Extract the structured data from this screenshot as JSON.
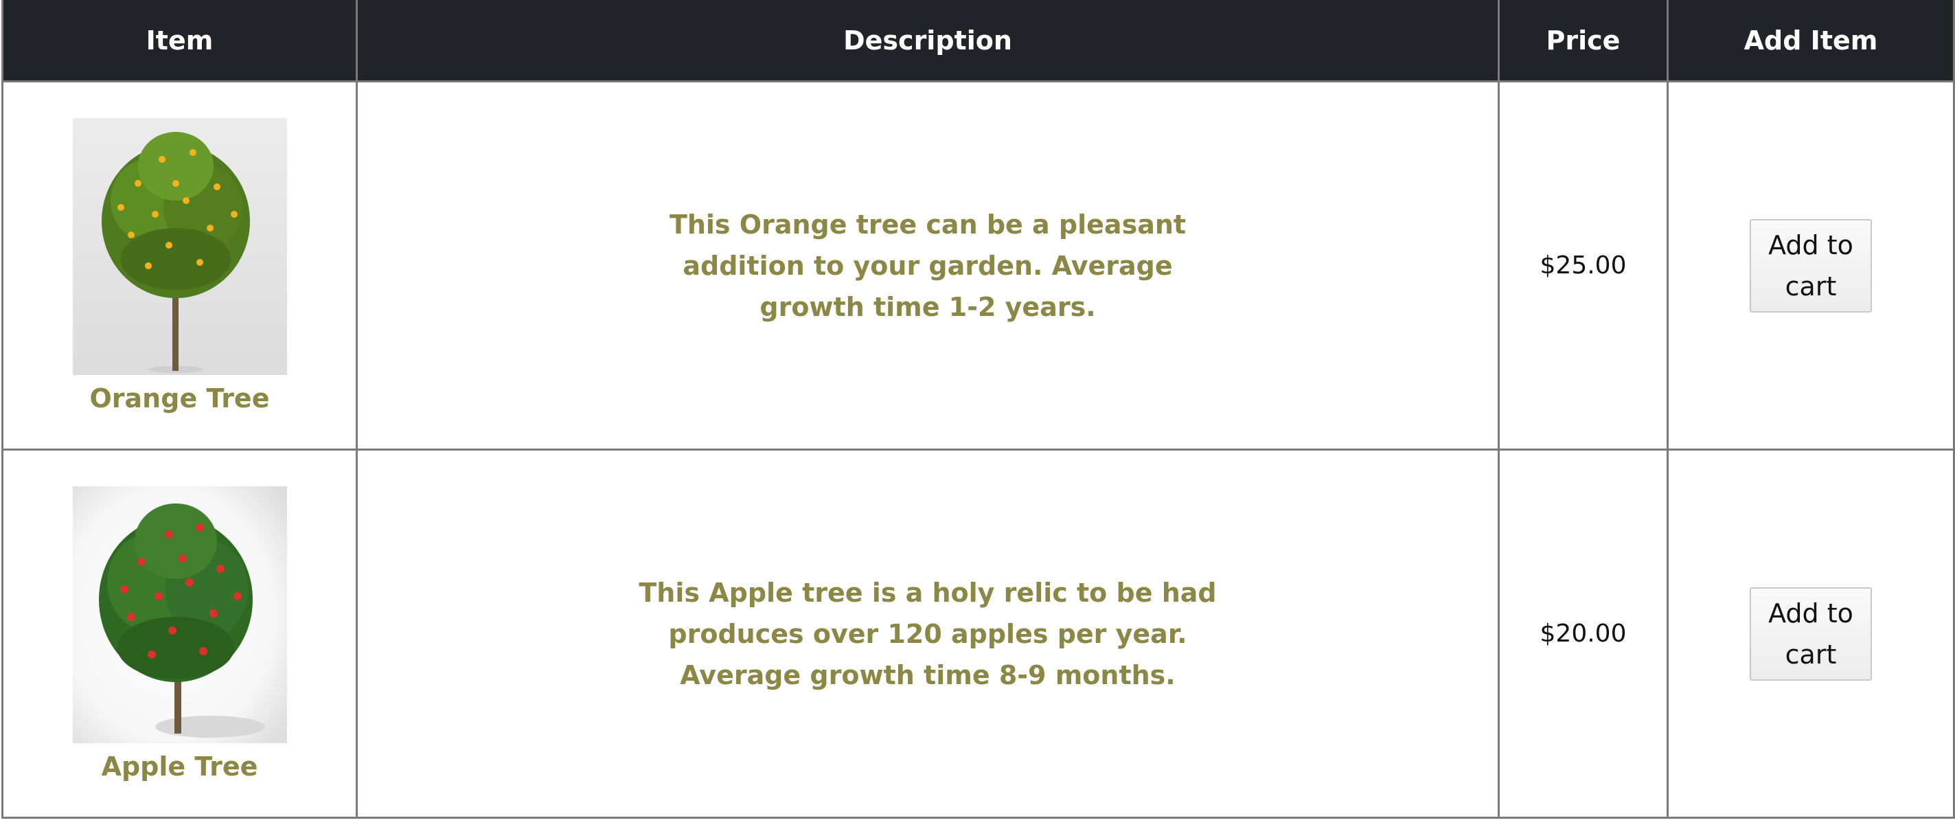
{
  "table": {
    "headers": [
      "Item",
      "Description",
      "Price",
      "Add Item"
    ],
    "rows": [
      {
        "name": "Orange Tree",
        "image": "orange-tree-image",
        "description": "This Orange tree can be a pleasant addition to your garden. Average growth time 1-2 years.",
        "price": "$25.00",
        "button_label": "Add to cart"
      },
      {
        "name": "Apple Tree",
        "image": "apple-tree-image",
        "description": "This Apple tree is a holy relic to be had produces over 120 apples per year. Average growth time 8-9 months.",
        "price": "$20.00",
        "button_label": "Add to cart"
      }
    ]
  },
  "colors": {
    "header_bg": "#212529",
    "header_text": "#ffffff",
    "accent_text": "#8b8745",
    "border": "#7a7a7a"
  }
}
